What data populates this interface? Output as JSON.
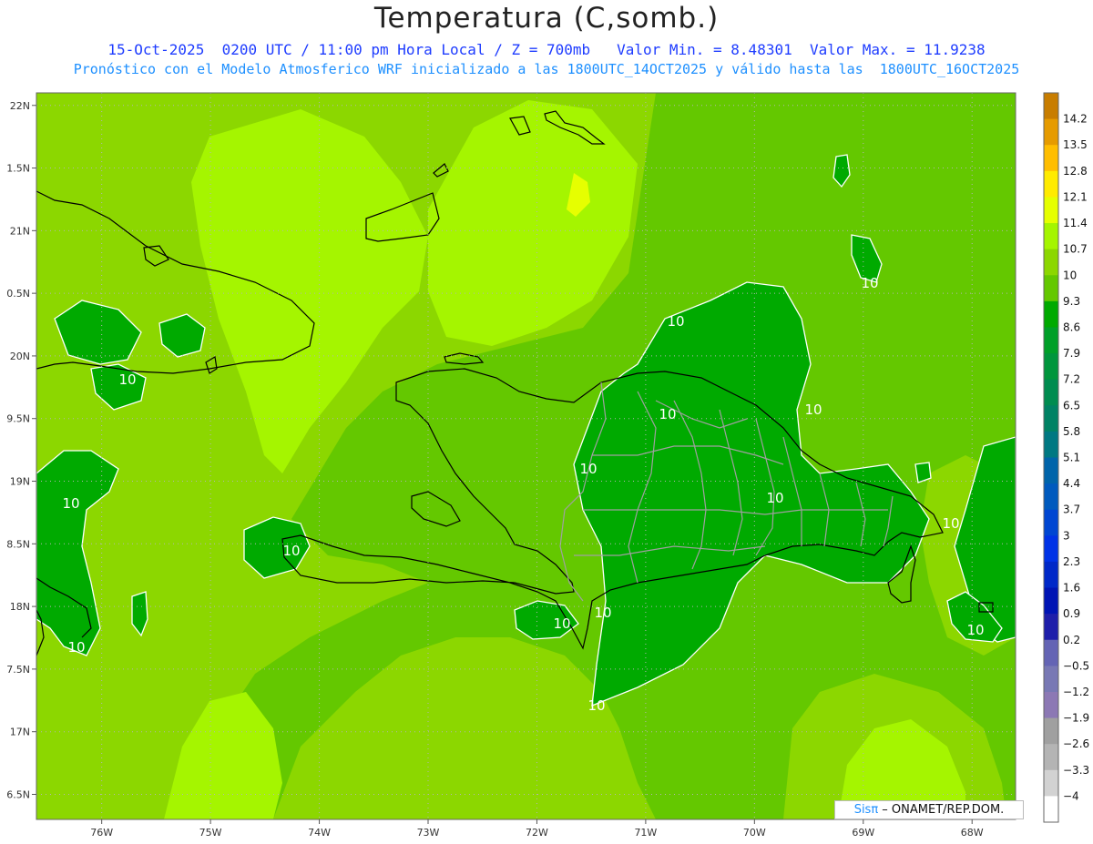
{
  "title": "Temperatura (C,somb.)",
  "subtitle_1": "15-Oct-2025  0200 UTC / 11:00 pm Hora Local / Z = 700mb   Valor Min. = 8.48301  Valor Max. = 11.9238",
  "subtitle_2": "Pronóstico con el Modelo Atmosferico WRF inicializado a las 1800UTC_14OCT2025 y válido hasta las  1800UTC_16OCT2025",
  "credit": {
    "logo": "Sisπ",
    "text": " – ONAMET/REP.DOM."
  },
  "colors": {
    "title": "#222222",
    "subtitle_1": "#1e3cff",
    "subtitle_2": "#1e90ff",
    "coast": "#000000",
    "provinces": "#a0a0a0",
    "contour": "#ffffff"
  },
  "map": {
    "lon_range": [
      -76.6,
      -67.6
    ],
    "lat_range": [
      16.3,
      22.1
    ],
    "lon_ticks": [
      "76W",
      "75W",
      "74W",
      "73W",
      "72W",
      "71W",
      "70W",
      "69W",
      "68W"
    ],
    "lat_ticks": [
      "22N",
      "1.5N",
      "21N",
      "0.5N",
      "20N",
      "9.5N",
      "19N",
      "8.5N",
      "18N",
      "7.5N",
      "17N",
      "6.5N"
    ],
    "contour_label": "10"
  },
  "colorbar": {
    "labels": [
      "14.2",
      "13.5",
      "12.8",
      "12.1",
      "11.4",
      "10.7",
      "10",
      "9.3",
      "8.6",
      "7.9",
      "7.2",
      "6.5",
      "5.8",
      "5.1",
      "4.4",
      "3.7",
      "3",
      "2.3",
      "1.6",
      "0.9",
      "0.2",
      "−0.5",
      "−1.2",
      "−1.9",
      "−2.6",
      "−3.3",
      "−4"
    ],
    "colors": [
      "#c87d00",
      "#e69b00",
      "#ffbe00",
      "#ffeb00",
      "#e6ff00",
      "#a5f500",
      "#8cd700",
      "#64c800",
      "#00aa00",
      "#00a028",
      "#00963c",
      "#008c50",
      "#008264",
      "#007882",
      "#0064aa",
      "#005abe",
      "#0046d2",
      "#0032e6",
      "#0028c8",
      "#0014b4",
      "#1e1eaa",
      "#6464b4",
      "#7878b4",
      "#8c78b4",
      "#a0a0a0",
      "#b4b4b4",
      "#d2d2d2",
      "#ffffff"
    ]
  }
}
